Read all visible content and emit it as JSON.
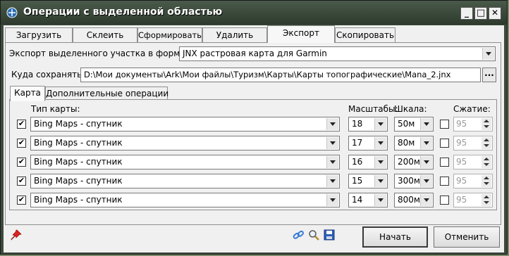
{
  "window": {
    "title": "Операции с выделенной областью",
    "controls": {
      "minimize": "_",
      "maximize": "□",
      "close": "✕"
    }
  },
  "tabs": [
    {
      "label": "Загрузить"
    },
    {
      "label": "Склеить"
    },
    {
      "label": "Сформировать"
    },
    {
      "label": "Удалить"
    },
    {
      "label": "Экспорт"
    },
    {
      "label": "Скопировать"
    }
  ],
  "active_tab": "Экспорт",
  "export": {
    "format_label": "Экспорт выделенного участка в формат",
    "format_value": "JNX растровая карта для Garmin",
    "save_label": "Куда сохранять:",
    "save_path": "D:\\Мои документы\\Ark\\Мои файлы\\Туризм\\Карты\\Карты топографические\\Mana_2.jnx",
    "browse_label": "..."
  },
  "subtabs": [
    {
      "label": "Карта"
    },
    {
      "label": "Дополнительные операции"
    }
  ],
  "columns": {
    "map_type": "Тип карты:",
    "scales": "Масштабы:",
    "scale_bar": "Шкала:",
    "compression": "Сжатие:"
  },
  "rows": [
    {
      "checked": true,
      "map": "Bing Maps - спутник",
      "zoom": "18",
      "scale": "50м",
      "compress_checked": false,
      "quality": "95"
    },
    {
      "checked": true,
      "map": "Bing Maps - спутник",
      "zoom": "17",
      "scale": "80м",
      "compress_checked": false,
      "quality": "95"
    },
    {
      "checked": true,
      "map": "Bing Maps - спутник",
      "zoom": "16",
      "scale": "200м",
      "compress_checked": false,
      "quality": "95"
    },
    {
      "checked": true,
      "map": "Bing Maps - спутник",
      "zoom": "15",
      "scale": "300м",
      "compress_checked": false,
      "quality": "95"
    },
    {
      "checked": true,
      "map": "Bing Maps - спутник",
      "zoom": "14",
      "scale": "800м",
      "compress_checked": false,
      "quality": "95"
    }
  ],
  "buttons": {
    "start": "Начать",
    "cancel": "Отменить"
  },
  "icons": {
    "pin": "pin-icon",
    "link": "link-icon",
    "zoom": "zoom-icon",
    "save": "save-icon"
  }
}
